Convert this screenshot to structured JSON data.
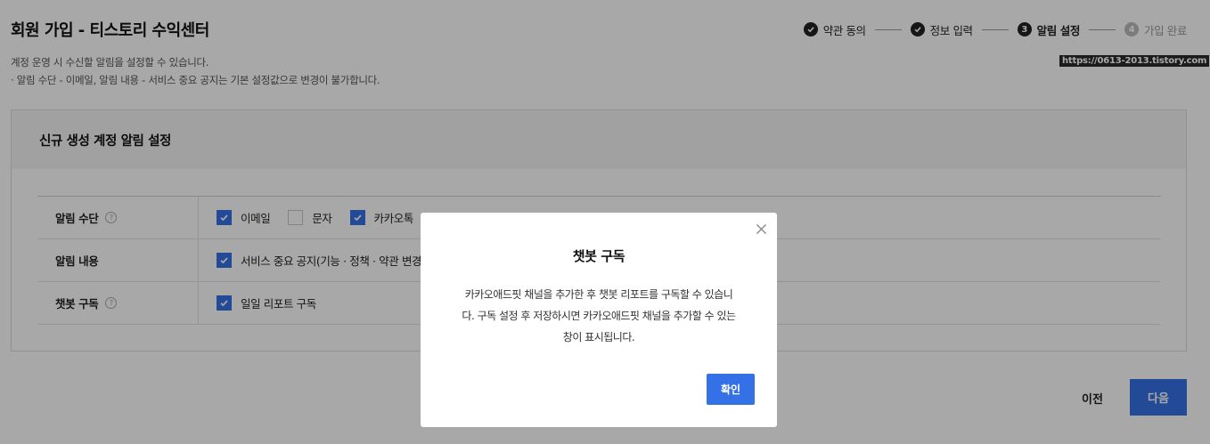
{
  "page": {
    "title": "회원 가입 - 티스토리 수익센터",
    "desc_line1": "계정 운영 시 수신할 알림을 설정할 수 있습니다.",
    "desc_line2": "· 알림 수단 - 이메일, 알림 내용 - 서비스 중요 공지는 기본 설정값으로 변경이 불가합니다.",
    "url_tag": "https://0613-2013.tistory.com"
  },
  "steps": [
    {
      "label": "약관 동의",
      "state": "done",
      "marker": ""
    },
    {
      "label": "정보 입력",
      "state": "done",
      "marker": ""
    },
    {
      "label": "알림 설정",
      "state": "current",
      "marker": "3"
    },
    {
      "label": "가입 완료",
      "state": "pending",
      "marker": "4"
    }
  ],
  "card": {
    "title": "신규 생성 계정 알림 설정",
    "rows": {
      "method": {
        "label": "알림 수단",
        "options": [
          {
            "label": "이메일",
            "checked": true
          },
          {
            "label": "문자",
            "checked": false
          },
          {
            "label": "카카오톡",
            "checked": true
          }
        ]
      },
      "content": {
        "label": "알림 내용",
        "options": [
          {
            "label": "서비스 중요 공지(기능 · 정책 · 약관 변경 등)",
            "checked": true
          }
        ]
      },
      "chatbot": {
        "label": "챗봇 구독",
        "options": [
          {
            "label": "일일 리포트 구독",
            "checked": true
          }
        ]
      }
    }
  },
  "buttons": {
    "prev": "이전",
    "next": "다음"
  },
  "modal": {
    "title": "챗봇 구독",
    "body_line1": "카카오애드핏 채널을 추가한 후 챗봇 리포트를 구독할 수 있습니",
    "body_line2": "다. 구독 설정 후 저장하시면 카카오애드핏 채널을 추가할 수 있는",
    "body_line3": "창이 표시됩니다.",
    "ok": "확인"
  },
  "colors": {
    "primary": "#3471e6",
    "overlay": "rgba(0,0,0,0.34)"
  },
  "icons": {
    "step_done": "check-circle-icon",
    "help": "question-circle-icon",
    "close": "close-icon",
    "checkbox": "checkmark-icon"
  }
}
